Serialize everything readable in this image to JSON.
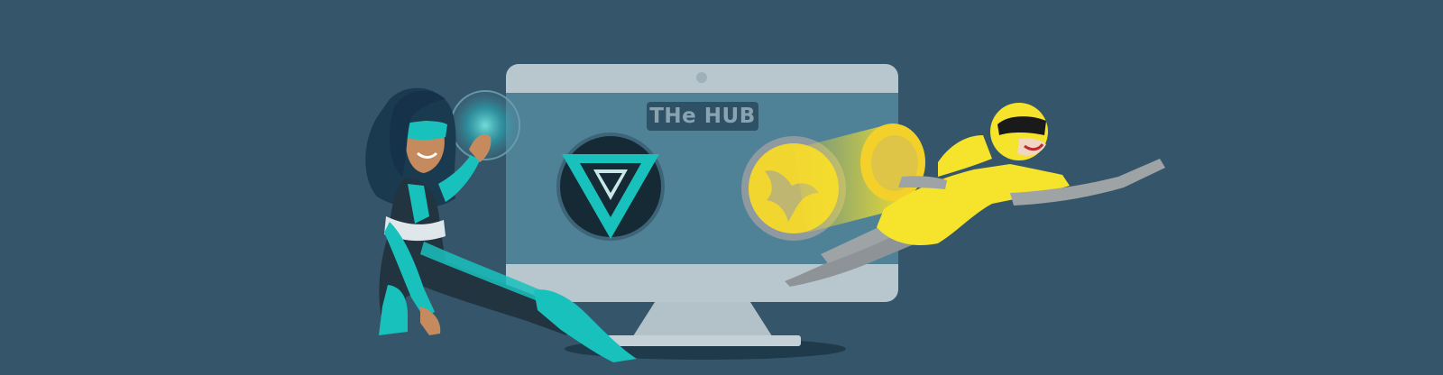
{
  "banner": {
    "hub_label": "THe HUB"
  },
  "colors": {
    "background": "#35566a",
    "monitor_frame": "#b8c6cd",
    "monitor_screen": "#4f8197",
    "teal_hero": "#19c1bd",
    "yellow_hero": "#f6e32b"
  },
  "icons": {
    "left_logo": "triangle-v-logo-icon",
    "right_logo": "bird-coin-logo-icon"
  }
}
